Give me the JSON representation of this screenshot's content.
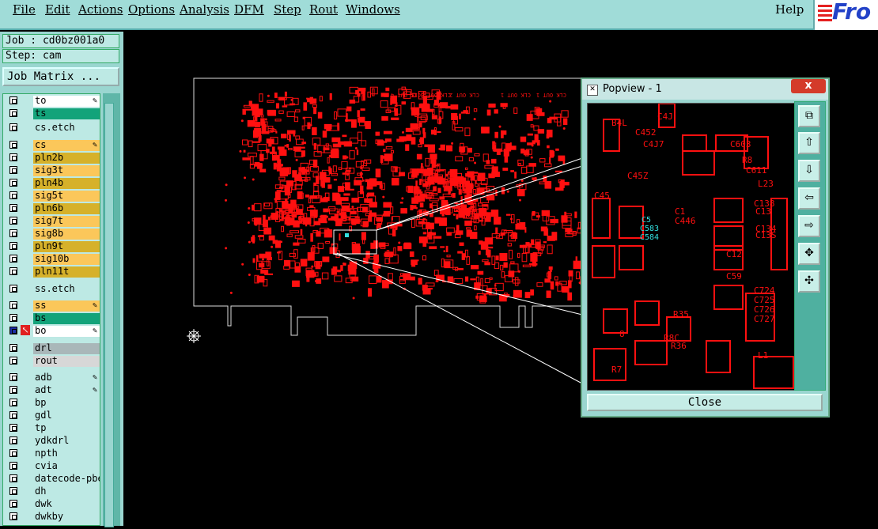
{
  "menu": {
    "items": [
      "File",
      "Edit",
      "Actions",
      "Options",
      "Analysis",
      "DFM",
      "Step",
      "Rout",
      "Windows"
    ],
    "help": "Help",
    "brand": "Fro"
  },
  "job": {
    "label": "Job : cd0bz001a0",
    "step": "Step: cam",
    "matrix_button": "Job Matrix ..."
  },
  "layers": [
    {
      "name": "to",
      "color": "#ffffff",
      "mark": "✎"
    },
    {
      "name": "ts",
      "color": "#13a37a",
      "mark": ""
    },
    {
      "name": "cs.etch",
      "color": "#bde9e4",
      "mark": ""
    },
    {
      "name": "cs",
      "color": "#fbc75a",
      "mark": "✎"
    },
    {
      "name": "pln2b",
      "color": "#d6b12a",
      "mark": ""
    },
    {
      "name": "sig3t",
      "color": "#fbc75a",
      "mark": ""
    },
    {
      "name": "pln4b",
      "color": "#d6b12a",
      "mark": ""
    },
    {
      "name": "sig5t",
      "color": "#fbc75a",
      "mark": ""
    },
    {
      "name": "pln6b",
      "color": "#d6b12a",
      "mark": ""
    },
    {
      "name": "sig7t",
      "color": "#fbc75a",
      "mark": ""
    },
    {
      "name": "sig8b",
      "color": "#fbc75a",
      "mark": ""
    },
    {
      "name": "pln9t",
      "color": "#d6b12a",
      "mark": ""
    },
    {
      "name": "sig10b",
      "color": "#fbc75a",
      "mark": ""
    },
    {
      "name": "pln11t",
      "color": "#d6b12a",
      "mark": ""
    },
    {
      "name": "ss.etch",
      "color": "#bde9e4",
      "mark": ""
    },
    {
      "name": "ss",
      "color": "#fbc75a",
      "mark": "✎"
    },
    {
      "name": "bs",
      "color": "#13a37a",
      "mark": ""
    },
    {
      "name": "bo",
      "color": "#ffffff",
      "mark": "✎"
    },
    {
      "name": "drl",
      "color": "#a9b7b9",
      "mark": ""
    },
    {
      "name": "rout",
      "color": "#d7d7d7",
      "mark": ""
    },
    {
      "name": "adb",
      "color": "#bde9e4",
      "mark": "✎"
    },
    {
      "name": "adt",
      "color": "#bde9e4",
      "mark": "✎"
    },
    {
      "name": "bp",
      "color": "#bde9e4",
      "mark": ""
    },
    {
      "name": "gdl",
      "color": "#bde9e4",
      "mark": ""
    },
    {
      "name": "tp",
      "color": "#bde9e4",
      "mark": ""
    },
    {
      "name": "ydkdrl",
      "color": "#bde9e4",
      "mark": ""
    },
    {
      "name": "npth",
      "color": "#bde9e4",
      "mark": ""
    },
    {
      "name": "cvia",
      "color": "#bde9e4",
      "mark": ""
    },
    {
      "name": "datecode-pbe",
      "color": "#bde9e4",
      "mark": ""
    },
    {
      "name": "dh",
      "color": "#bde9e4",
      "mark": ""
    },
    {
      "name": "dwk",
      "color": "#bde9e4",
      "mark": ""
    },
    {
      "name": "dwkby",
      "color": "#bde9e4",
      "mark": ""
    }
  ],
  "popview": {
    "title": "Popview - 1",
    "close_button": "Close",
    "close_x": "x",
    "silk_labels": [
      "B4L",
      "C452",
      "C4J",
      "C4J7",
      "C45",
      "C45Z",
      "C603",
      "R8",
      "C611",
      "L23",
      "C138",
      "C13",
      "C134",
      "C13S",
      "C12",
      "C59",
      "C724",
      "C725",
      "C726",
      "C727",
      "R35",
      "R8C",
      "L1",
      "R7",
      "C1",
      "C446",
      "8",
      "R36"
    ],
    "cyan_labels": [
      "C5",
      "C583",
      "C584"
    ]
  },
  "board": {
    "top_labels": [
      "CLK OUT 4",
      "CLK OUT 3",
      "CLK OUT 2",
      "CLK OUT 1",
      "CLK OUT 1"
    ]
  }
}
